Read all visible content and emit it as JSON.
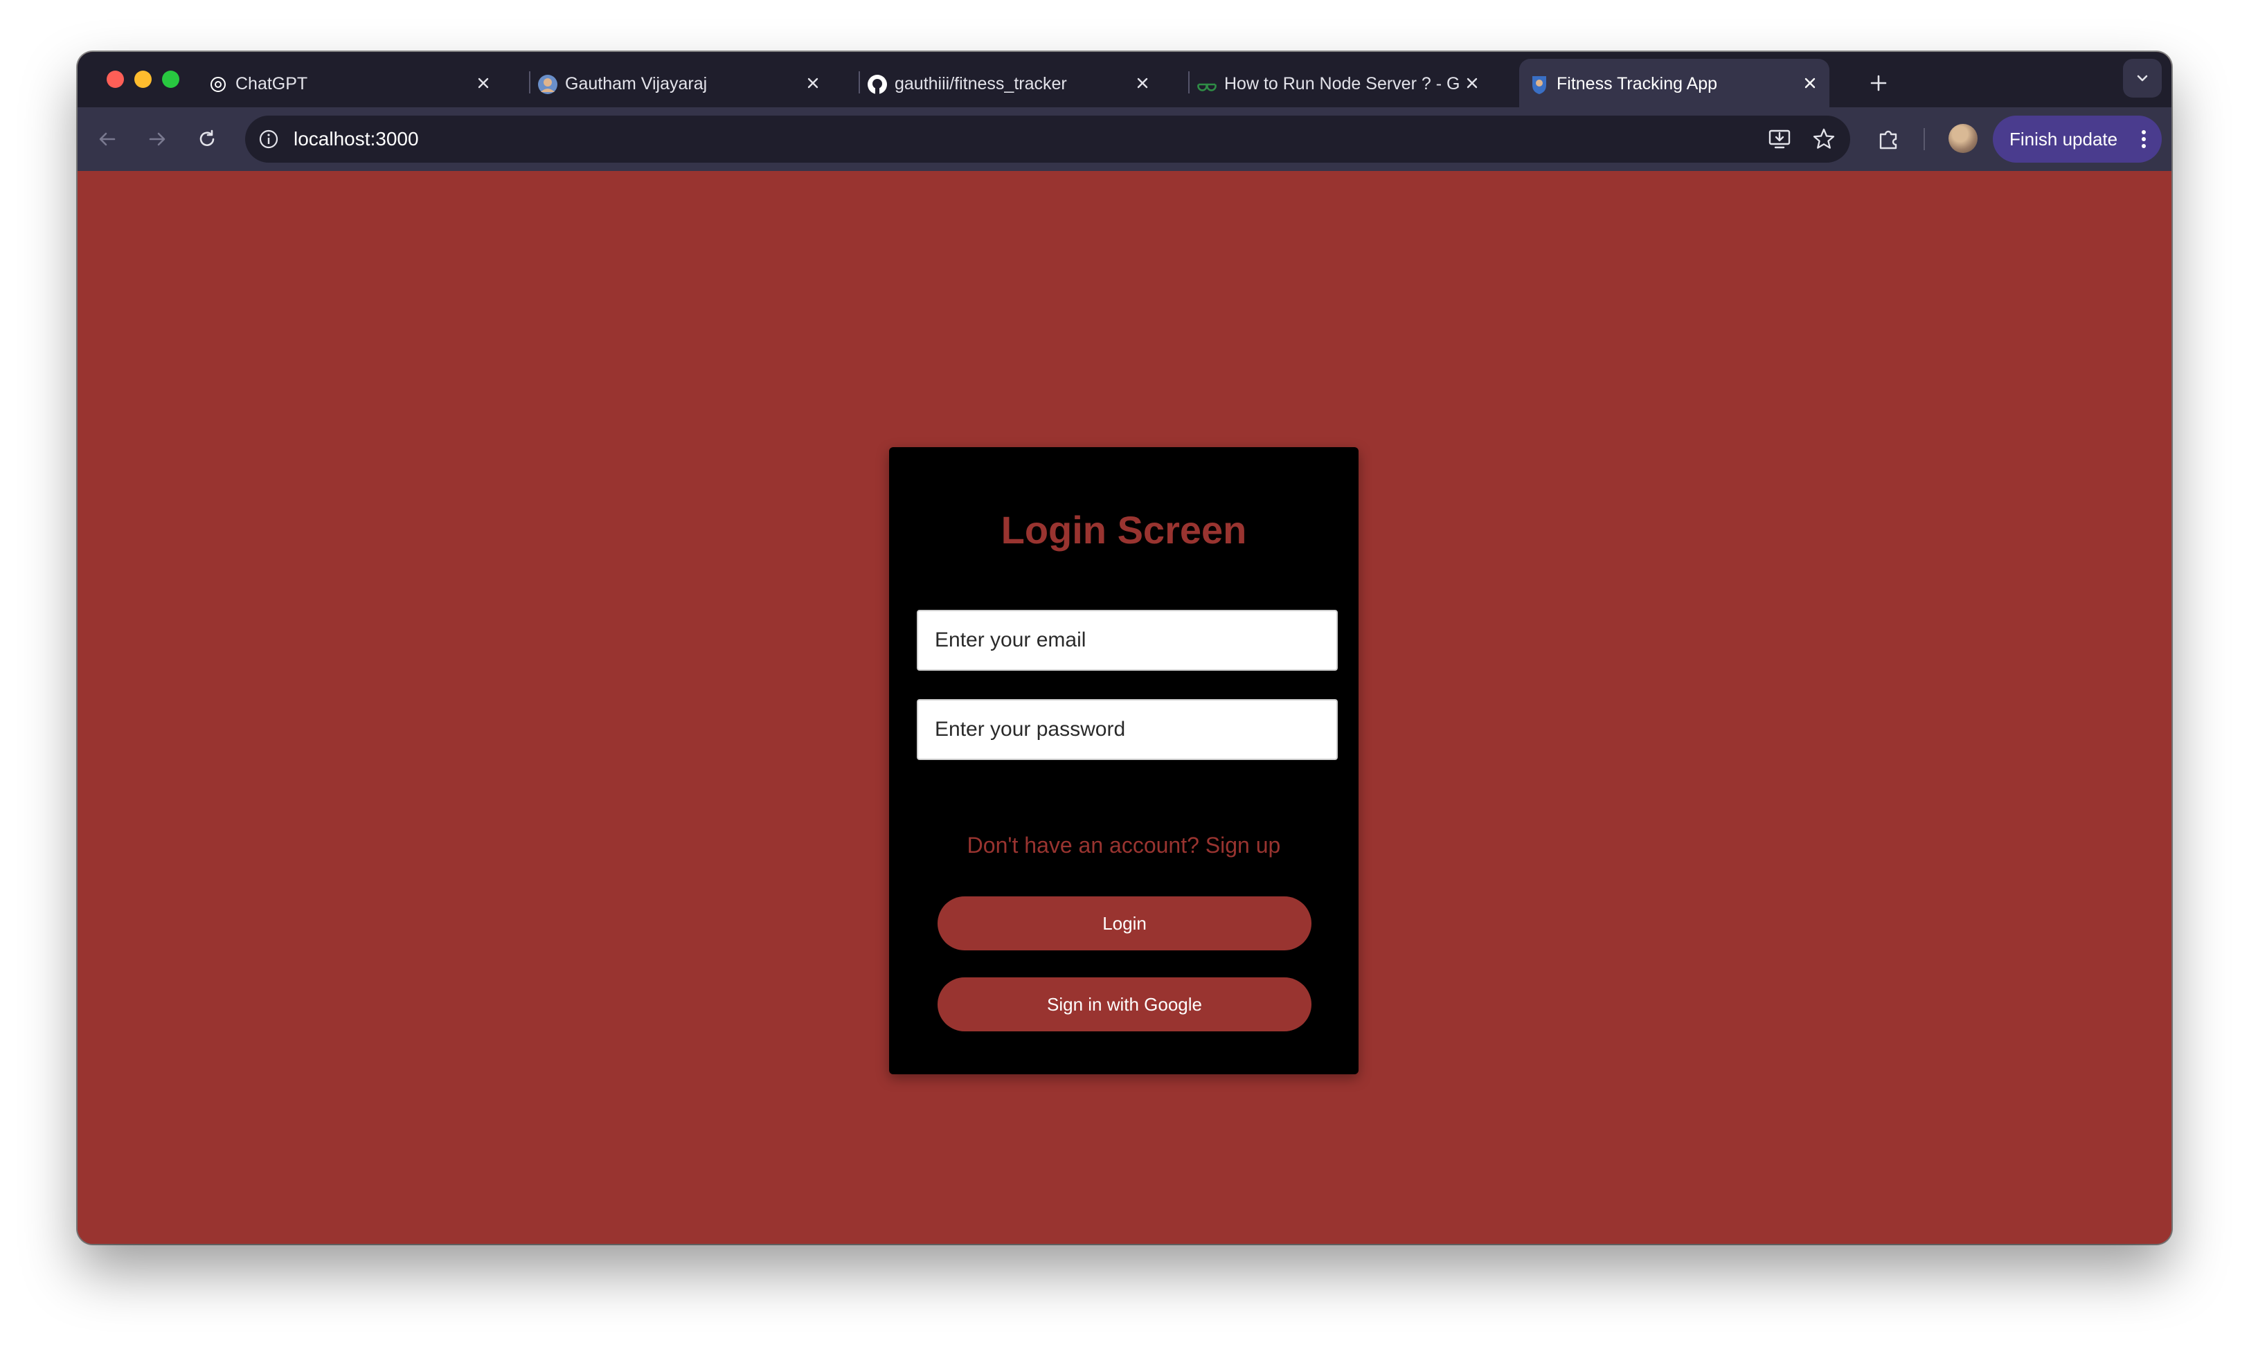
{
  "browser": {
    "tabs": [
      {
        "title": "ChatGPT",
        "icon": "chatgpt-icon"
      },
      {
        "title": "Gautham Vijayaraj",
        "icon": "avatar-icon"
      },
      {
        "title": "gauthiii/fitness_tracker",
        "icon": "github-icon"
      },
      {
        "title": "How to Run Node Server ? - G",
        "icon": "geeksforgeeks-icon"
      },
      {
        "title": "Fitness Tracking App",
        "icon": "app-favicon-icon",
        "active": true
      }
    ],
    "url": "localhost:3000",
    "finish_update_label": "Finish update"
  },
  "login": {
    "title": "Login Screen",
    "email_placeholder": "Enter your email",
    "password_placeholder": "Enter your password",
    "signup_text": "Don't have an account? Sign up",
    "login_button": "Login",
    "google_button": "Sign in with Google"
  },
  "colors": {
    "page_background": "#993430",
    "card_background": "#000000",
    "accent": "#993430",
    "button_text": "#ffffff",
    "browser_frame": "#1f1e2c",
    "toolbar": "#35344a",
    "finish_update": "#4a3c8e"
  }
}
